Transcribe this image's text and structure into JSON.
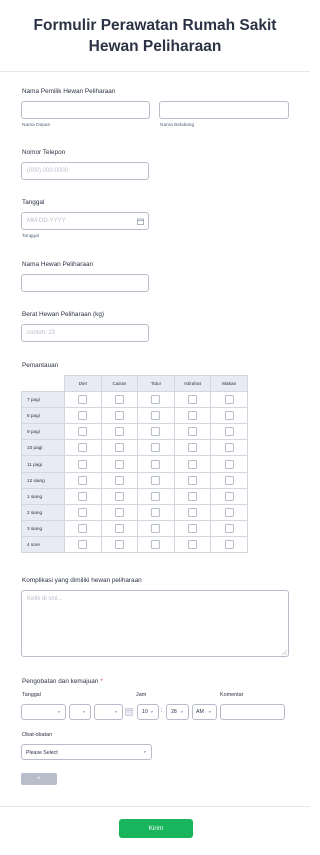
{
  "header": {
    "title": "Formulir Perawatan Rumah Sakit Hewan Peliharaan"
  },
  "owner_name": {
    "label": "Nama Pemilik Hewan Peliharaan",
    "first_sublabel": "Nama Depan",
    "last_sublabel": "Nama Belakang",
    "first_value": "",
    "last_value": ""
  },
  "phone": {
    "label": "Nomor Telepon",
    "placeholder": "(000) 000-0000",
    "value": ""
  },
  "date": {
    "label": "Tanggal",
    "placeholder": "MM-DD-YYYY",
    "sublabel": "Tanggal",
    "value": ""
  },
  "pet_name": {
    "label": "Nama Hewan Peliharaan",
    "value": ""
  },
  "pet_weight": {
    "label": "Berat Hewan Peliharaan (kg)",
    "placeholder": "contoh: 23",
    "value": ""
  },
  "monitoring": {
    "label": "Pemantauan",
    "columns": [
      "Diet",
      "Cairan",
      "Tidur",
      "Istirahat",
      "Makan"
    ],
    "rows": [
      "7 pagi",
      "8 pagi",
      "9 pagi",
      "10 pagi",
      "11 pagi",
      "12 siang",
      "1 siang",
      "2 siang",
      "3 siang",
      "4 sore"
    ]
  },
  "complications": {
    "label": "Komplikasi yang dimiliki hewan peliharaan",
    "placeholder": "Ketik di sini...",
    "value": ""
  },
  "treatment": {
    "label": "Pengobatan dan kemajuan",
    "required_mark": "*",
    "col_date": "Tanggal",
    "col_time": "Jam",
    "col_comment": "Komentar",
    "hour": "10",
    "minute": "28",
    "ampm": "AM",
    "time_sep": ":",
    "drug_label": "Obat-obatan",
    "drug_selected": "Please Select",
    "add_button": "+"
  },
  "submit": {
    "label": "Kirim"
  },
  "icons": {
    "calendar": "calendar-icon",
    "chevron": "chevron-down-icon"
  },
  "colors": {
    "accent": "#18b55d",
    "required": "#f23a3c",
    "border": "#b8bdc9",
    "header_cell": "#e8ebf3",
    "add_button": "#b8bdc9"
  }
}
